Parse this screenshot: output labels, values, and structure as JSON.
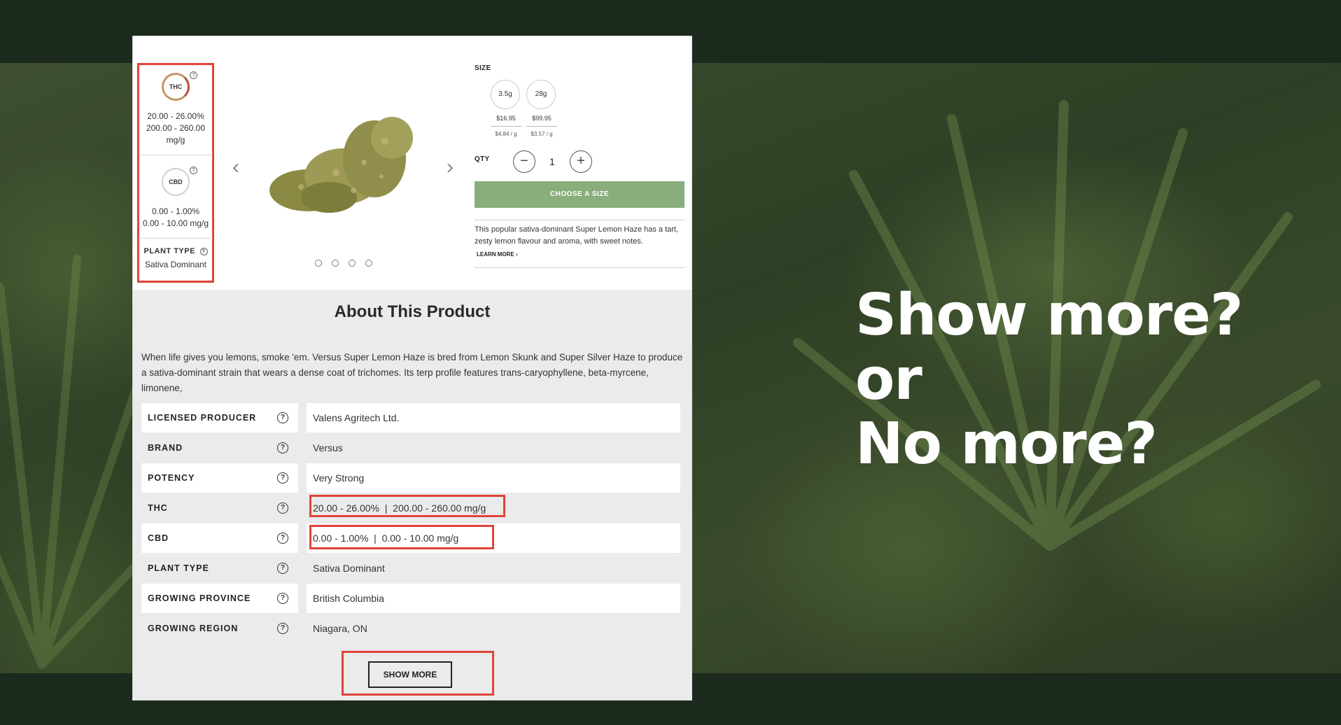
{
  "headline": {
    "line1": "Show more?",
    "line2": "or",
    "line3": "No more?"
  },
  "potency": {
    "thc": {
      "label": "THC",
      "percent": "20.00 - 26.00%",
      "mg_line1": "200.00 - 260.00",
      "mg_line2": "mg/g"
    },
    "cbd": {
      "label": "CBD",
      "percent": "0.00 - 1.00%",
      "mg": "0.00 - 10.00 mg/g"
    },
    "plant_type": {
      "label": "PLANT TYPE",
      "value": "Sativa Dominant"
    }
  },
  "gallery": {
    "prev": "‹",
    "next": "›",
    "dot_count": 4
  },
  "buy": {
    "size_label": "SIZE",
    "sizes": [
      {
        "name": "3.5g",
        "price": "$16.95",
        "per": "$4.84 / g"
      },
      {
        "name": "28g",
        "price": "$99.95",
        "per": "$3.57 / g"
      }
    ],
    "qty_label": "QTY",
    "qty_value": "1",
    "minus": "−",
    "plus": "+",
    "choose_label": "CHOOSE A SIZE",
    "short_desc": "This popular sativa-dominant Super Lemon Haze has a tart, zesty lemon flavour and aroma, with sweet notes.",
    "learn_more": "LEARN MORE ›"
  },
  "about": {
    "title": "About This Product",
    "text": "When life gives you lemons, smoke 'em. Versus Super Lemon Haze is bred from Lemon Skunk and Super Silver Haze to produce a sativa-dominant strain that wears a dense coat of trichomes. Its terp profile features trans-caryophyllene, beta-myrcene, limonene,",
    "help_glyph": "?",
    "specs": [
      {
        "key": "LICENSED PRODUCER",
        "value": "Valens Agritech Ltd."
      },
      {
        "key": "BRAND",
        "value": "Versus"
      },
      {
        "key": "POTENCY",
        "value": "Very Strong"
      },
      {
        "key": "THC",
        "value": "20.00 - 26.00%  |  200.00 - 260.00 mg/g"
      },
      {
        "key": "CBD",
        "value": "0.00 - 1.00%  |  0.00 - 10.00 mg/g"
      },
      {
        "key": "PLANT TYPE",
        "value": "Sativa Dominant"
      },
      {
        "key": "GROWING PROVINCE",
        "value": "British Columbia"
      },
      {
        "key": "GROWING REGION",
        "value": "Niagara, ON"
      }
    ],
    "show_more": "SHOW MORE"
  },
  "colors": {
    "accent_green": "#8aad7c",
    "highlight_red": "#e0443a",
    "page_dark": "#1c2a1d"
  }
}
